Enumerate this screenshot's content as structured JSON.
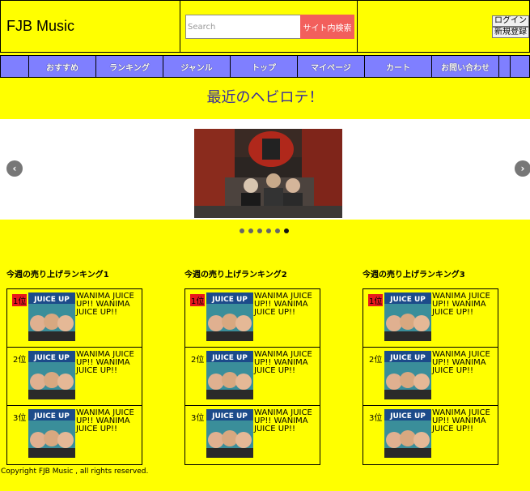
{
  "header": {
    "logo": "FJB Music",
    "search_placeholder": "Search",
    "search_button": "サイト内検索",
    "login_button": "ログイン",
    "register_button": "新規登録"
  },
  "nav": {
    "items": [
      "おすすめ",
      "ランキング",
      "ジャンル",
      "トップ",
      "マイページ",
      "カート",
      "お問い合わせ"
    ]
  },
  "heading": "最近のヘビロテ！",
  "carousel": {
    "prev_icon": "chevron-left-icon",
    "next_icon": "chevron-right-icon",
    "slide_count": 6,
    "active_slide": 6
  },
  "rankings": [
    {
      "title": "今週の売り上げランキング1",
      "entries": [
        {
          "rank": "1位",
          "text": "WANIMA JUICE UP!! WANIMA JUICE UP!!"
        },
        {
          "rank": "2位",
          "text": "WANIMA JUICE UP!! WANIMA JUICE UP!!"
        },
        {
          "rank": "3位",
          "text": "WANIMA JUICE UP!! WANIMA JUICE UP!!"
        }
      ]
    },
    {
      "title": "今週の売り上げランキング2",
      "entries": [
        {
          "rank": "1位",
          "text": "WANIMA JUICE UP!! WANIMA JUICE UP!!"
        },
        {
          "rank": "2位",
          "text": "WANIMA JUICE UP!! WANIMA JUICE UP!!"
        },
        {
          "rank": "3位",
          "text": "WANIMA JUICE UP!! WANIMA JUICE UP!!"
        }
      ]
    },
    {
      "title": "今週の売り上げランキング3",
      "entries": [
        {
          "rank": "1位",
          "text": "WANIMA JUICE UP!! WANIMA JUICE UP!!"
        },
        {
          "rank": "2位",
          "text": "WANIMA JUICE UP!! WANIMA JUICE UP!!"
        },
        {
          "rank": "3位",
          "text": "WANIMA JUICE UP!! WANIMA JUICE UP!!"
        }
      ]
    }
  ],
  "footer": "Copyright FJB Music , all rights reserved.",
  "colors": {
    "background": "#ffff00",
    "nav": "#7f7fff",
    "search_button": "#f25f5c",
    "rank_first": "#e8181d",
    "heading": "#3a2e9a"
  }
}
